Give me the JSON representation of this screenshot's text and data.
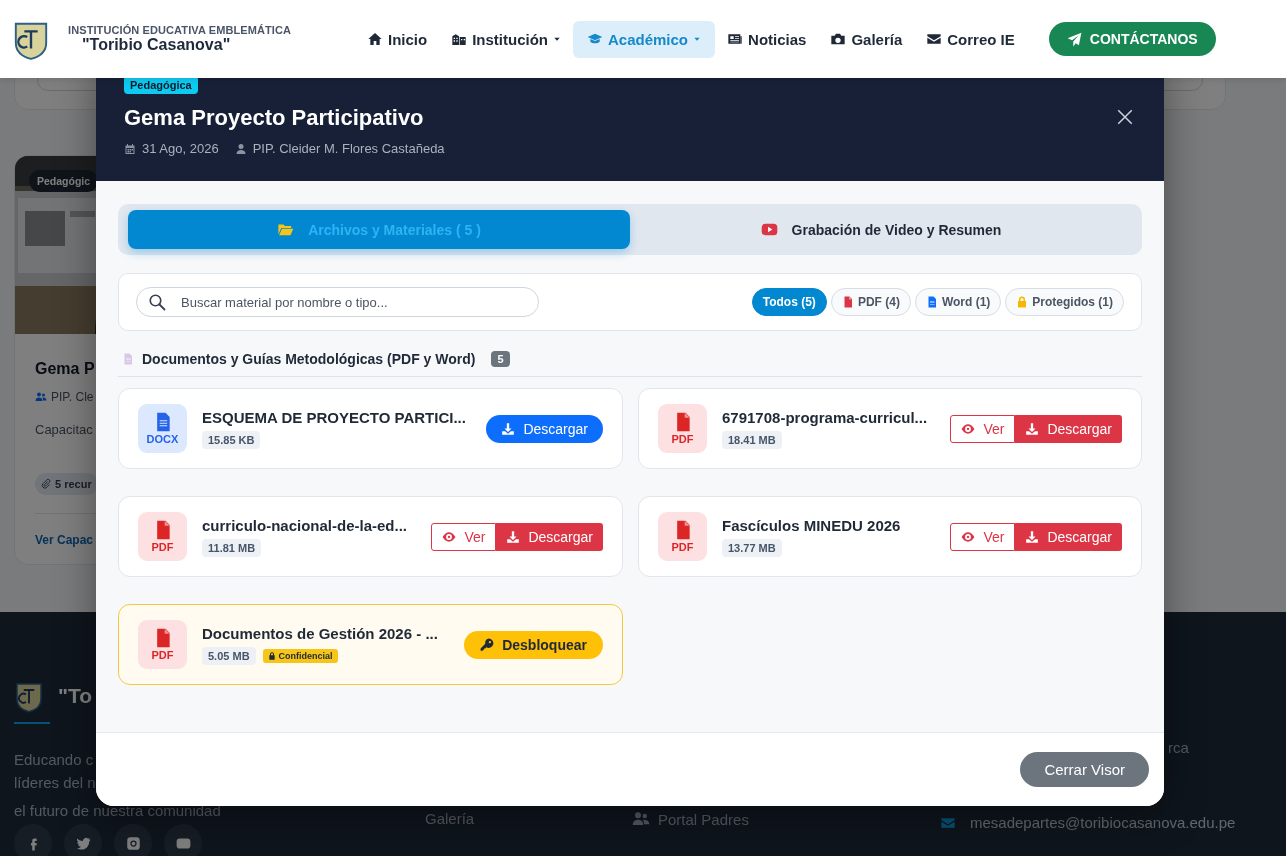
{
  "page": {
    "header": {
      "school_line1": "INSTITUCIÓN EDUCATIVA EMBLEMÁTICA",
      "school_line2": "\"Toribio Casanova\"",
      "nav": [
        {
          "label": "Inicio",
          "selected": false,
          "dropdown": false
        },
        {
          "label": "Institución",
          "selected": false,
          "dropdown": true
        },
        {
          "label": "Académico",
          "selected": true,
          "dropdown": true
        },
        {
          "label": "Noticias",
          "selected": false,
          "dropdown": false
        },
        {
          "label": "Galería",
          "selected": false,
          "dropdown": false
        },
        {
          "label": "Correo IE",
          "selected": false,
          "dropdown": false
        }
      ],
      "contact_button": "CONTÁCTANOS"
    },
    "card": {
      "badge": "Pedagógic",
      "title": "Gema P",
      "author": "PIP. Cle",
      "description": "Capacitac",
      "resources": "5 recur",
      "link": "Ver Capac"
    },
    "footer": {
      "brand": "\"To",
      "tagline_lines": [
        "Educando c",
        "líderes del n",
        "el futuro de nuestra comunidad"
      ],
      "links": [
        "Galería"
      ],
      "portal": "Portal Padres",
      "address_fragment": "rca",
      "email": "mesadepartes@toribiocasanova.edu.pe"
    }
  },
  "modal": {
    "category": "Pedagógica",
    "title": "Gema Proyecto Participativo",
    "date": "31 Ago, 2026",
    "author": "PIP. Cleider M. Flores Castañeda",
    "tabs": [
      {
        "label": "Archivos y Materiales (  5  )",
        "selected": true
      },
      {
        "label": "Grabación de Video y Resumen",
        "selected": false
      }
    ],
    "search": {
      "placeholder": "Buscar material por nombre o tipo..."
    },
    "filters": [
      {
        "kind": "all",
        "label": "Todos (5)",
        "selected": true
      },
      {
        "kind": "pdf",
        "label": "PDF (4)",
        "selected": false
      },
      {
        "kind": "word",
        "label": "Word (1)",
        "selected": false
      },
      {
        "kind": "protected",
        "label": "Protegidos (1)",
        "selected": false
      }
    ],
    "section": {
      "title": "Documentos y Guías Metodológicas (PDF y Word)",
      "count": "5"
    },
    "files": [
      {
        "kind": "docx",
        "type_label": "DOCX",
        "name": "ESQUEMA DE PROYECTO PARTICI...",
        "size": "15.85 KB",
        "protected": false,
        "actions": [
          {
            "kind": "download",
            "label": "Descargar"
          }
        ]
      },
      {
        "kind": "pdf",
        "type_label": "PDF",
        "name": "6791708-programa-curricul...",
        "size": "18.41 MB",
        "protected": false,
        "actions": [
          {
            "kind": "view",
            "label": "Ver"
          },
          {
            "kind": "download",
            "label": "Descargar"
          }
        ]
      },
      {
        "kind": "pdf",
        "type_label": "PDF",
        "name": "curriculo-nacional-de-la-ed...",
        "size": "11.81 MB",
        "protected": false,
        "actions": [
          {
            "kind": "view",
            "label": "Ver"
          },
          {
            "kind": "download",
            "label": "Descargar"
          }
        ]
      },
      {
        "kind": "pdf",
        "type_label": "PDF",
        "name": "Fascículos MINEDU 2026",
        "size": "13.77 MB",
        "protected": false,
        "actions": [
          {
            "kind": "view",
            "label": "Ver"
          },
          {
            "kind": "download",
            "label": "Descargar"
          }
        ]
      },
      {
        "kind": "pdf",
        "type_label": "PDF",
        "name": "Documentos de Gestión 2026 - ...",
        "size": "5.05 MB",
        "protected": true,
        "tag": "Confidencial",
        "actions": [
          {
            "kind": "unlock",
            "label": "Desbloquear"
          }
        ]
      }
    ],
    "close_button": "Cerrar Visor"
  }
}
